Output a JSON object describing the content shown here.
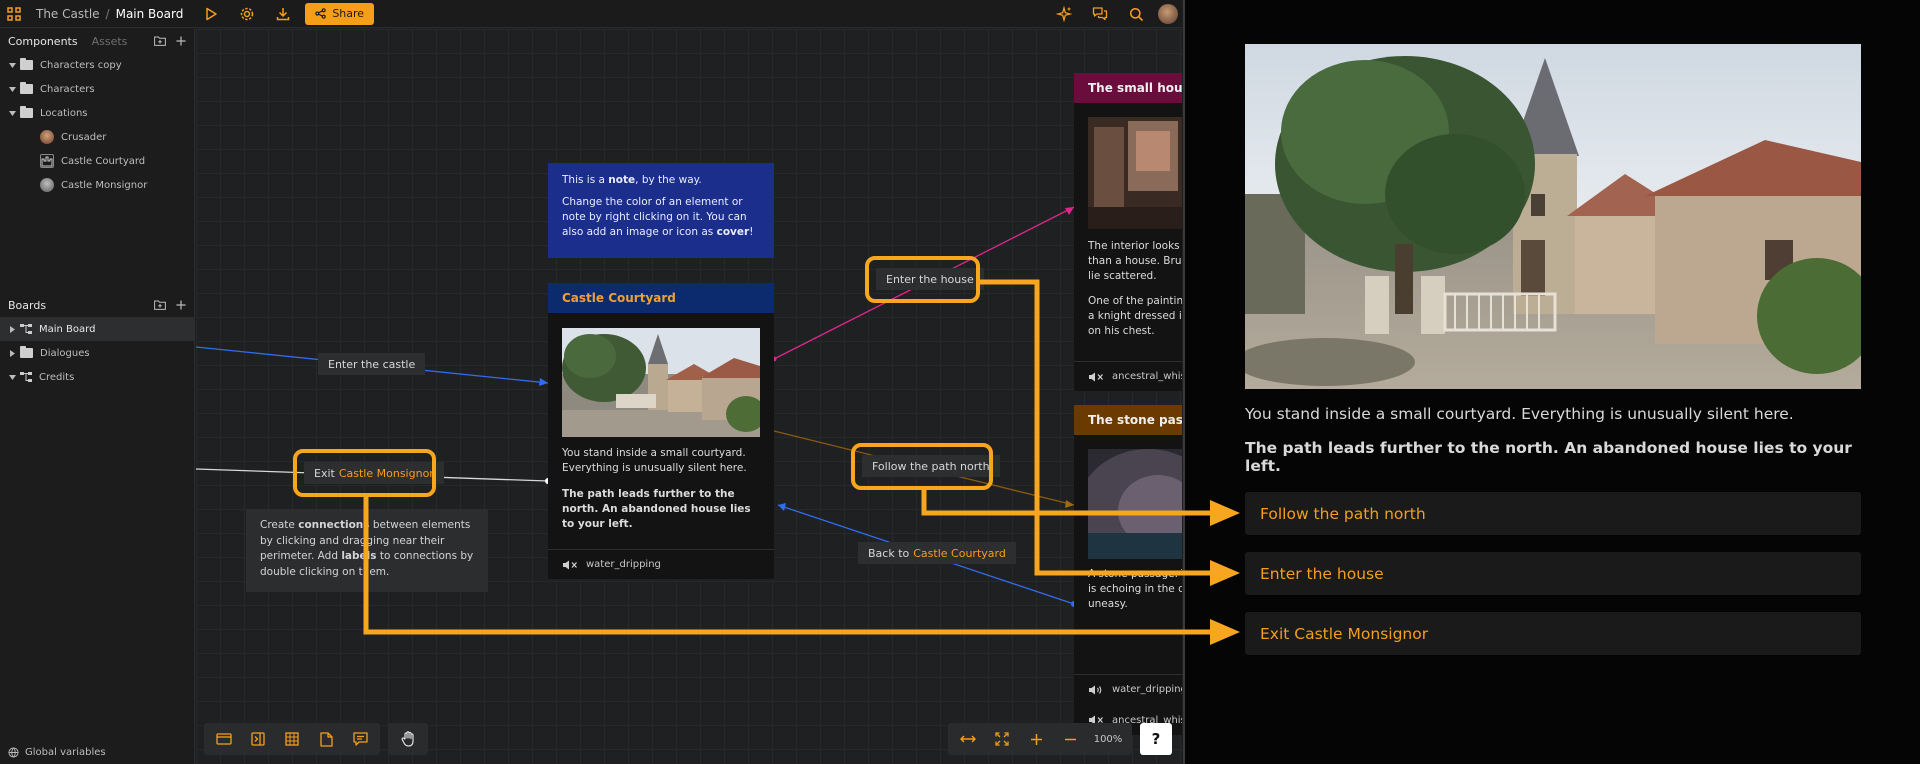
{
  "topbar": {
    "project": "The Castle",
    "separator": "/",
    "board": "Main Board",
    "share_label": "Share"
  },
  "sidebar": {
    "components_tab": "Components",
    "assets_tab": "Assets",
    "tree": [
      {
        "label": "Characters copy",
        "type": "folder"
      },
      {
        "label": "Characters",
        "type": "folder"
      },
      {
        "label": "Locations",
        "type": "folder"
      },
      {
        "label": "Crusader",
        "type": "item"
      },
      {
        "label": "Castle Courtyard",
        "type": "item"
      },
      {
        "label": "Castle Monsignor",
        "type": "item"
      }
    ],
    "boards_title": "Boards",
    "boards": [
      {
        "label": "Main Board"
      },
      {
        "label": "Dialogues"
      },
      {
        "label": "Credits"
      }
    ],
    "global_variables": "Global variables"
  },
  "canvas": {
    "note_blue": {
      "line1_pre": "This is a ",
      "line1_bold": "note",
      "line1_post": ", by the way.",
      "line2_pre": "Change the color of an element or note by right clicking on it. You can also add an image or icon as ",
      "line2_bold": "cover",
      "line2_post": "!"
    },
    "note_grey": {
      "p1": "Create ",
      "b1": "connections",
      "p2": " between elements by clicking and dragging near their perimeter. Add ",
      "b2": "labels",
      "p3": " to connections by double clicking on them."
    },
    "courtyard": {
      "title": "Castle Courtyard",
      "text1": "You stand inside a small courtyard. Everything is unusually silent here.",
      "text2": "The path leads further to the north. An abandoned house lies to your left.",
      "sound": "water_dripping"
    },
    "small_house": {
      "title": "The small house",
      "text1": "The interior looks more like a studio than a house. Brushes and paintings lie scattered.",
      "text2": "One of the paintings shows a figure: a knight dressed in white, a red cross on his chest.",
      "sound": "ancestral_whisper"
    },
    "stone_passage": {
      "title": "The stone passage",
      "text1": "A stone passage. The sound of water is echoing in the dark. You feel uneasy.",
      "sound1": "water_dripping",
      "sound2": "ancestral_whisper"
    },
    "labels": {
      "enter_castle": "Enter the castle",
      "exit_pre": "Exit",
      "exit_hl": "Castle Monsignor",
      "enter_house": "Enter the house",
      "follow_path": "Follow the path north",
      "back_pre": "Back to",
      "back_hl": "Castle Courtyard"
    },
    "zoom": "100%",
    "help": "?"
  },
  "preview": {
    "text1": "You stand inside a small courtyard. Everything is unusually silent here.",
    "text2": "The path leads further to the north. An abandoned house lies to your left.",
    "choices": [
      "Follow the path north",
      "Enter the house",
      "Exit Castle Monsignor"
    ]
  },
  "colors": {
    "accent": "#f59e1a",
    "highlight": "#f8a520",
    "note_blue": "#1c2e8c",
    "house_header": "#6a0d3c",
    "passage_header": "#6b3a00",
    "courtyard_header": "#0b2b6e"
  }
}
